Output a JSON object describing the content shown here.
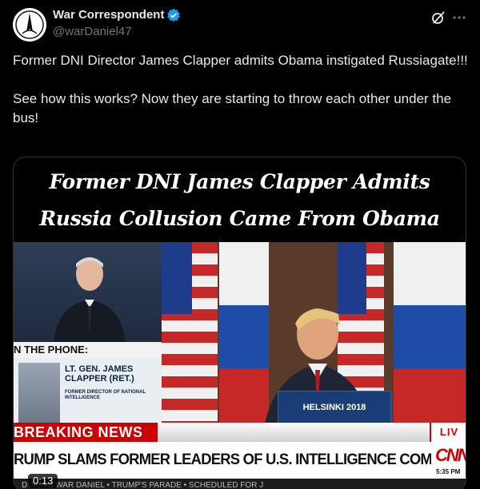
{
  "post": {
    "author_name": "War Correspondent",
    "author_handle": "@warDaniel47",
    "text": "Former DNI Director James Clapper admits Obama instigated Russiagate!!!\n\nSee how this works? Now they are starting to throw each other under the bus!"
  },
  "media": {
    "headline_line1": "Former DNI James Clapper Admits",
    "headline_line2": "Russia Collusion Came From Obama",
    "video": {
      "phone_label": "N THE PHONE:",
      "guest_name": "LT. GEN. JAMES CLAPPER (RET.)",
      "guest_title": "FORMER DIRECTOR OF NATIONAL INTELLIGENCE",
      "podium_label": "HELSINKI 2018",
      "breaking_label": "BREAKING NEWS",
      "live_label": "LIV",
      "chyron_text": "RUMP SLAMS FORMER LEADERS OF U.S. INTELLIGENCE COMMUNITY",
      "network_logo": "CNN",
      "clock": "5:35 PM",
      "ticker_text": "DURING WAR DANIEL • TRUMP'S PARADE • SCHEDULED FOR J",
      "timestamp": "0:13"
    }
  },
  "icons": {
    "verified": "verified-badge-icon",
    "grok": "grok-icon",
    "more": "more-icon"
  },
  "colors": {
    "background": "#000000",
    "text_primary": "#e7e9ea",
    "text_secondary": "#71767b",
    "verified_blue": "#1d9bf0",
    "cnn_red": "#cc0000"
  }
}
